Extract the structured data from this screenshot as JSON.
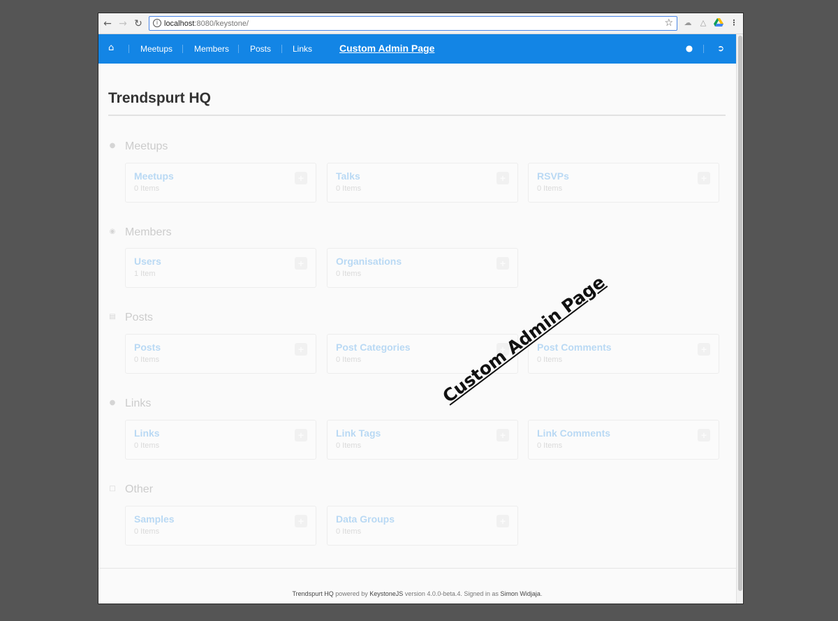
{
  "browser": {
    "url_host": "localhost",
    "url_rest": ":8080/keystone/",
    "back_icon": "back-arrow-icon",
    "forward_icon": "forward-arrow-icon",
    "reload_icon": "reload-icon"
  },
  "navbar": {
    "color": "#1385e5",
    "home_icon": "home-icon",
    "links": [
      "Meetups",
      "Members",
      "Posts",
      "Links"
    ],
    "custom_link": "Custom Admin Page"
  },
  "page": {
    "title": "Trendspurt HQ"
  },
  "sections": [
    {
      "label": "Meetups",
      "icon": "dot-icon",
      "cards": [
        {
          "title": "Meetups",
          "count": "0 Items"
        },
        {
          "title": "Talks",
          "count": "0 Items"
        },
        {
          "title": "RSVPs",
          "count": "0 Items"
        }
      ]
    },
    {
      "label": "Members",
      "icon": "globe-icon",
      "cards": [
        {
          "title": "Users",
          "count": "1 Item"
        },
        {
          "title": "Organisations",
          "count": "0 Items"
        }
      ]
    },
    {
      "label": "Posts",
      "icon": "newspaper-icon",
      "cards": [
        {
          "title": "Posts",
          "count": "0 Items"
        },
        {
          "title": "Post Categories",
          "count": "0 Items"
        },
        {
          "title": "Post Comments",
          "count": "0 Items"
        }
      ]
    },
    {
      "label": "Links",
      "icon": "dot-icon",
      "cards": [
        {
          "title": "Links",
          "count": "0 Items"
        },
        {
          "title": "Link Tags",
          "count": "0 Items"
        },
        {
          "title": "Link Comments",
          "count": "0 Items"
        }
      ]
    },
    {
      "label": "Other",
      "icon": "square-icon",
      "cards": [
        {
          "title": "Samples",
          "count": "0 Items"
        },
        {
          "title": "Data Groups",
          "count": "0 Items"
        }
      ]
    }
  ],
  "footer": {
    "site": "Trendspurt HQ",
    "powered_by": "powered by",
    "framework": "KeystoneJS",
    "version": "version 4.0.0-beta.4. Signed in as",
    "user": "Simon Widjaja",
    "end": "."
  },
  "overlay": {
    "stamp_text": "Custom Admin Page"
  }
}
